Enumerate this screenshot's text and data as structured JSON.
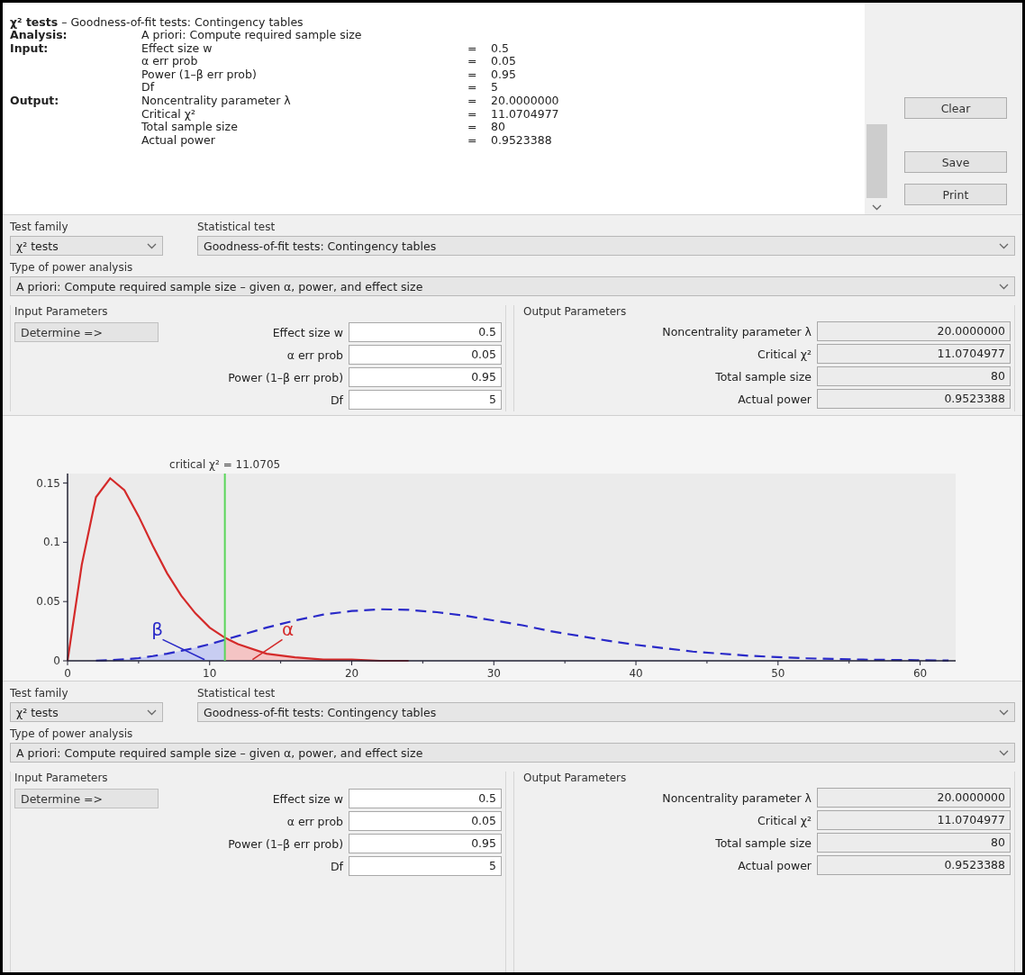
{
  "log": {
    "header": "**χ² tests** – Goodness-of-fit tests: Contingency tables",
    "rows": [
      {
        "section": "Analysis:",
        "name": "A priori: Compute required sample size"
      },
      {
        "section": "Input:",
        "name": "Effect size w",
        "equals": "=",
        "value": "0.5"
      },
      {
        "name": "α err prob",
        "equals": "=",
        "value": "0.05"
      },
      {
        "name": "Power (1–β err prob)",
        "equals": "=",
        "value": "0.95"
      },
      {
        "name": "Df",
        "equals": "=",
        "value": "5"
      },
      {
        "section": "Output:",
        "name": "Noncentrality parameter λ",
        "equals": "=",
        "value": "20.0000000"
      },
      {
        "name": "Critical χ²",
        "equals": "=",
        "value": "11.0704977"
      },
      {
        "name": "Total sample size",
        "equals": "=",
        "value": "80"
      },
      {
        "name": "Actual power",
        "equals": "=",
        "value": "0.9523388"
      }
    ],
    "buttons": [
      "Clear",
      "Save",
      "Print"
    ]
  },
  "top_form": {
    "test_family_label": "Test family",
    "test_family": "χ² tests",
    "statistical_test_label": "Statistical test",
    "statistical_test": "Goodness-of-fit tests: Contingency tables",
    "analysis_label": "Type of power analysis",
    "analysis": "A priori: Compute required sample size – given α, power, and effect size",
    "input": {
      "title": "Input Parameters",
      "button": "Determine =>",
      "fields": [
        {
          "label": "Effect size w",
          "value": "0.5"
        },
        {
          "label": "α err prob",
          "value": "0.05"
        },
        {
          "label": "Power (1–β err prob)",
          "value": "0.95"
        },
        {
          "label": "Df",
          "value": "5"
        }
      ]
    },
    "output": {
      "title": "Output Parameters",
      "fields": [
        {
          "label": "Noncentrality parameter λ",
          "value": "20.0000000"
        },
        {
          "label": "Critical χ²",
          "value": "11.0704977"
        },
        {
          "label": "Total sample size",
          "value": "80"
        },
        {
          "label": "Actual power",
          "value": "0.9523388"
        }
      ]
    }
  },
  "plot": {
    "chart_data": {
      "type": "line",
      "xlim": [
        0,
        62.5
      ],
      "ylim": [
        0,
        0.158
      ],
      "xticks": [
        0,
        10,
        20,
        30,
        40,
        50,
        60
      ],
      "yticks": [
        {
          "value": 0,
          "label": "0"
        },
        {
          "value": 0.05,
          "label": "0.05"
        },
        {
          "value": 0.1,
          "label": "0.1"
        },
        {
          "value": 0.15,
          "label": "0.15"
        }
      ],
      "x": [
        0,
        1,
        2,
        3,
        4,
        5,
        6,
        7,
        8,
        9,
        10,
        11,
        12,
        14,
        16,
        18,
        20,
        22,
        24,
        26,
        28,
        30,
        32,
        34,
        36,
        38,
        40,
        44,
        48,
        52,
        56,
        60,
        62
      ],
      "series": [
        {
          "color": "#d42a2a",
          "line_style": "solid",
          "values": [
            0,
            0.081,
            0.138,
            0.154,
            0.144,
            0.122,
            0.097,
            0.074,
            0.055,
            0.04,
            0.028,
            0.02,
            0.014,
            0.006,
            0.003,
            0.001,
            0.001,
            0,
            0,
            null,
            null,
            null,
            null,
            null,
            null,
            null,
            null,
            null,
            null,
            null,
            null,
            null,
            null
          ]
        },
        {
          "color": "#2a2ac8",
          "line_style": "dashed",
          "values": [
            null,
            null,
            0.0002,
            0.0005,
            0.0012,
            0.0023,
            0.004,
            0.006,
            0.0085,
            0.011,
            0.014,
            0.0175,
            0.021,
            0.028,
            0.034,
            0.039,
            0.042,
            0.0435,
            0.043,
            0.041,
            0.038,
            0.034,
            0.03,
            0.025,
            0.021,
            0.017,
            0.0135,
            0.0078,
            0.0042,
            0.0021,
            0.001,
            0.0005,
            0.0003
          ]
        }
      ],
      "ref_lines": [
        {
          "axis": "x",
          "value": 11.0705,
          "label": "critical χ² = 11.0705",
          "color": "#5ad65a"
        }
      ],
      "annotations": [
        "β",
        "α"
      ]
    }
  },
  "bottom_form": {
    "test_family_label": "Test family",
    "test_family": "χ² tests",
    "statistical_test_label": "Statistical test",
    "statistical_test": "Goodness-of-fit tests: Contingency tables",
    "analysis_label": "Type of power analysis",
    "analysis": "A priori: Compute required sample size – given α, power, and effect size",
    "input": {
      "title": "Input Parameters",
      "button": "Determine =>",
      "fields": [
        {
          "label": "Effect size w",
          "value": "0.5"
        },
        {
          "label": "α err prob",
          "value": "0.05"
        },
        {
          "label": "Power (1–β err prob)",
          "value": "0.95"
        },
        {
          "label": "Df",
          "value": "5"
        }
      ]
    },
    "output": {
      "title": "Output Parameters",
      "fields": [
        {
          "label": "Noncentrality parameter λ",
          "value": "20.0000000"
        },
        {
          "label": "Critical χ²",
          "value": "11.0704977"
        },
        {
          "label": "Total sample size",
          "value": "80"
        },
        {
          "label": "Actual power",
          "value": "0.9523388"
        }
      ]
    }
  }
}
